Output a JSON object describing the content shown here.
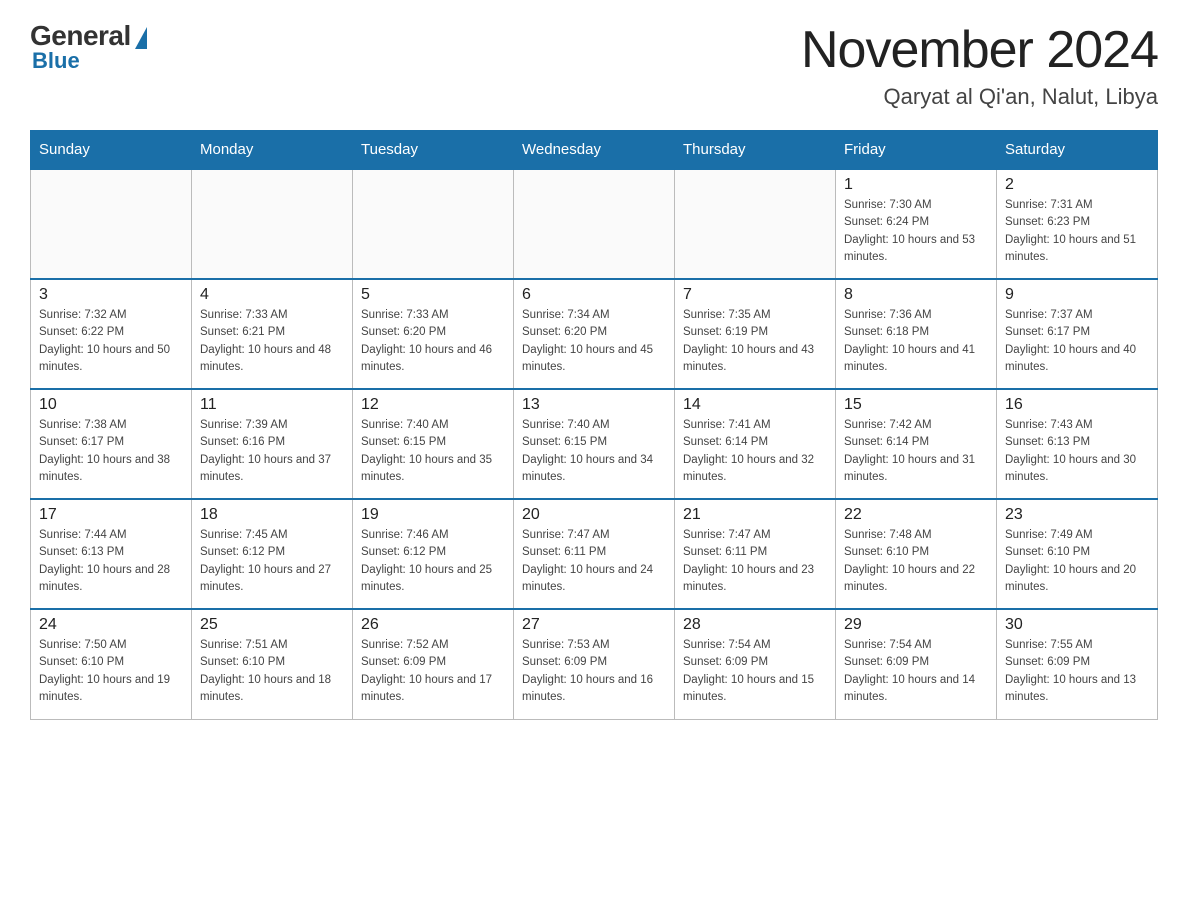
{
  "logo": {
    "general": "General",
    "blue": "Blue"
  },
  "title": {
    "month": "November 2024",
    "location": "Qaryat al Qi'an, Nalut, Libya"
  },
  "weekdays": [
    "Sunday",
    "Monday",
    "Tuesday",
    "Wednesday",
    "Thursday",
    "Friday",
    "Saturday"
  ],
  "weeks": [
    [
      {
        "day": "",
        "info": ""
      },
      {
        "day": "",
        "info": ""
      },
      {
        "day": "",
        "info": ""
      },
      {
        "day": "",
        "info": ""
      },
      {
        "day": "",
        "info": ""
      },
      {
        "day": "1",
        "info": "Sunrise: 7:30 AM\nSunset: 6:24 PM\nDaylight: 10 hours and 53 minutes."
      },
      {
        "day": "2",
        "info": "Sunrise: 7:31 AM\nSunset: 6:23 PM\nDaylight: 10 hours and 51 minutes."
      }
    ],
    [
      {
        "day": "3",
        "info": "Sunrise: 7:32 AM\nSunset: 6:22 PM\nDaylight: 10 hours and 50 minutes."
      },
      {
        "day": "4",
        "info": "Sunrise: 7:33 AM\nSunset: 6:21 PM\nDaylight: 10 hours and 48 minutes."
      },
      {
        "day": "5",
        "info": "Sunrise: 7:33 AM\nSunset: 6:20 PM\nDaylight: 10 hours and 46 minutes."
      },
      {
        "day": "6",
        "info": "Sunrise: 7:34 AM\nSunset: 6:20 PM\nDaylight: 10 hours and 45 minutes."
      },
      {
        "day": "7",
        "info": "Sunrise: 7:35 AM\nSunset: 6:19 PM\nDaylight: 10 hours and 43 minutes."
      },
      {
        "day": "8",
        "info": "Sunrise: 7:36 AM\nSunset: 6:18 PM\nDaylight: 10 hours and 41 minutes."
      },
      {
        "day": "9",
        "info": "Sunrise: 7:37 AM\nSunset: 6:17 PM\nDaylight: 10 hours and 40 minutes."
      }
    ],
    [
      {
        "day": "10",
        "info": "Sunrise: 7:38 AM\nSunset: 6:17 PM\nDaylight: 10 hours and 38 minutes."
      },
      {
        "day": "11",
        "info": "Sunrise: 7:39 AM\nSunset: 6:16 PM\nDaylight: 10 hours and 37 minutes."
      },
      {
        "day": "12",
        "info": "Sunrise: 7:40 AM\nSunset: 6:15 PM\nDaylight: 10 hours and 35 minutes."
      },
      {
        "day": "13",
        "info": "Sunrise: 7:40 AM\nSunset: 6:15 PM\nDaylight: 10 hours and 34 minutes."
      },
      {
        "day": "14",
        "info": "Sunrise: 7:41 AM\nSunset: 6:14 PM\nDaylight: 10 hours and 32 minutes."
      },
      {
        "day": "15",
        "info": "Sunrise: 7:42 AM\nSunset: 6:14 PM\nDaylight: 10 hours and 31 minutes."
      },
      {
        "day": "16",
        "info": "Sunrise: 7:43 AM\nSunset: 6:13 PM\nDaylight: 10 hours and 30 minutes."
      }
    ],
    [
      {
        "day": "17",
        "info": "Sunrise: 7:44 AM\nSunset: 6:13 PM\nDaylight: 10 hours and 28 minutes."
      },
      {
        "day": "18",
        "info": "Sunrise: 7:45 AM\nSunset: 6:12 PM\nDaylight: 10 hours and 27 minutes."
      },
      {
        "day": "19",
        "info": "Sunrise: 7:46 AM\nSunset: 6:12 PM\nDaylight: 10 hours and 25 minutes."
      },
      {
        "day": "20",
        "info": "Sunrise: 7:47 AM\nSunset: 6:11 PM\nDaylight: 10 hours and 24 minutes."
      },
      {
        "day": "21",
        "info": "Sunrise: 7:47 AM\nSunset: 6:11 PM\nDaylight: 10 hours and 23 minutes."
      },
      {
        "day": "22",
        "info": "Sunrise: 7:48 AM\nSunset: 6:10 PM\nDaylight: 10 hours and 22 minutes."
      },
      {
        "day": "23",
        "info": "Sunrise: 7:49 AM\nSunset: 6:10 PM\nDaylight: 10 hours and 20 minutes."
      }
    ],
    [
      {
        "day": "24",
        "info": "Sunrise: 7:50 AM\nSunset: 6:10 PM\nDaylight: 10 hours and 19 minutes."
      },
      {
        "day": "25",
        "info": "Sunrise: 7:51 AM\nSunset: 6:10 PM\nDaylight: 10 hours and 18 minutes."
      },
      {
        "day": "26",
        "info": "Sunrise: 7:52 AM\nSunset: 6:09 PM\nDaylight: 10 hours and 17 minutes."
      },
      {
        "day": "27",
        "info": "Sunrise: 7:53 AM\nSunset: 6:09 PM\nDaylight: 10 hours and 16 minutes."
      },
      {
        "day": "28",
        "info": "Sunrise: 7:54 AM\nSunset: 6:09 PM\nDaylight: 10 hours and 15 minutes."
      },
      {
        "day": "29",
        "info": "Sunrise: 7:54 AM\nSunset: 6:09 PM\nDaylight: 10 hours and 14 minutes."
      },
      {
        "day": "30",
        "info": "Sunrise: 7:55 AM\nSunset: 6:09 PM\nDaylight: 10 hours and 13 minutes."
      }
    ]
  ]
}
